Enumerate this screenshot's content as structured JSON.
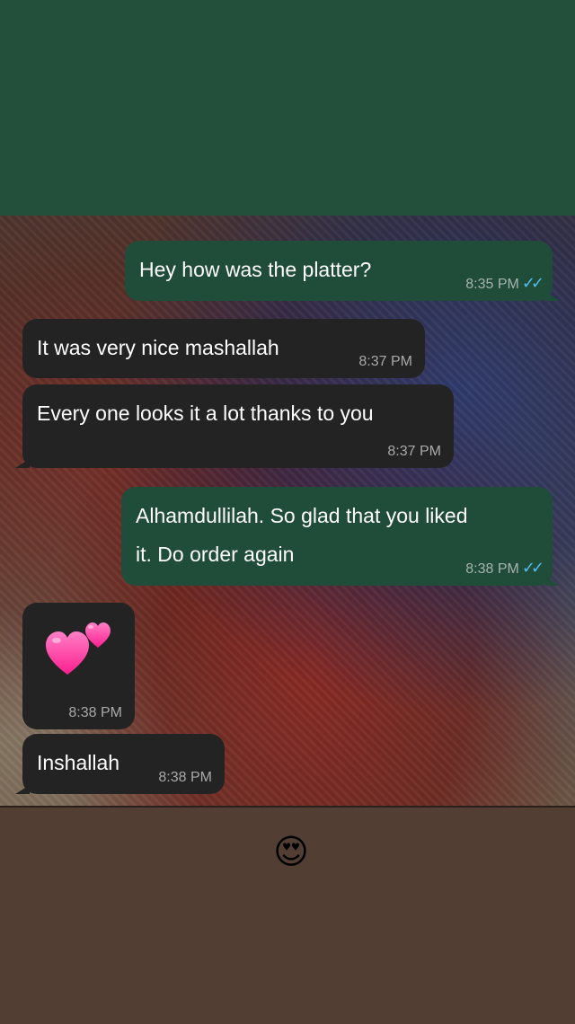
{
  "messages": [
    {
      "direction": "outgoing",
      "text": "Hey how was the platter?",
      "time": "8:35 PM",
      "status": "read"
    },
    {
      "direction": "incoming",
      "text": "It was very nice mashallah",
      "time": "8:37 PM"
    },
    {
      "direction": "incoming",
      "text": "Every one looks it a lot thanks to you",
      "time": "8:37 PM"
    },
    {
      "direction": "outgoing",
      "text": "Alhamdullilah. So glad that you liked it. Do order again",
      "line1": "Alhamdullilah. So glad that you liked",
      "line2": "it. Do order again",
      "time": "8:38 PM",
      "status": "read"
    },
    {
      "direction": "incoming",
      "type": "emoji",
      "emoji": "💕",
      "time": "8:38 PM"
    },
    {
      "direction": "incoming",
      "text": "Inshallah",
      "time": "8:38 PM"
    }
  ],
  "read_receipt": "✓✓",
  "sticker": {
    "emoji": "😍",
    "icon": "heart-eyes-emoji"
  },
  "colors": {
    "top_band": "#22503b",
    "outgoing_bubble": "#1f4d39",
    "incoming_bubble": "#232323",
    "bottom_band": "#533e33",
    "read_tick": "#53bdeb"
  }
}
